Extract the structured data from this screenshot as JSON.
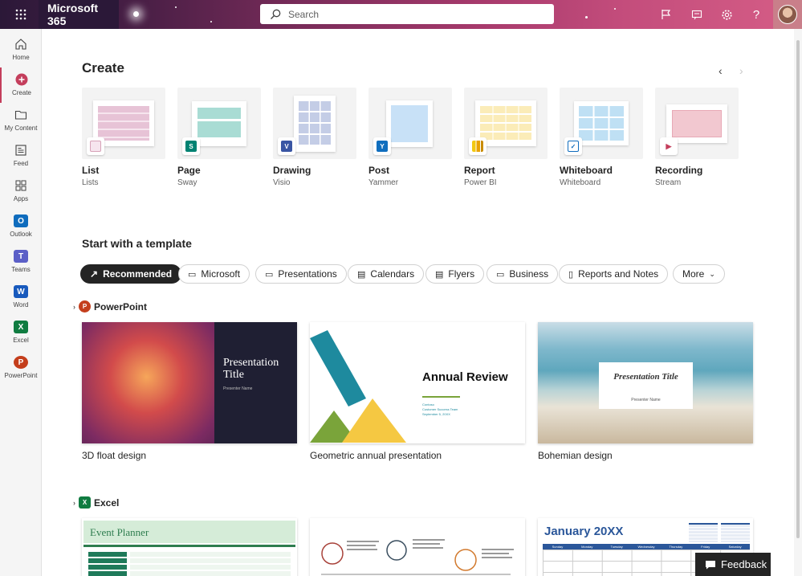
{
  "topbar": {
    "brand": "Microsoft 365",
    "search_placeholder": "Search",
    "icons": [
      "waffle-icon",
      "flag-icon",
      "feedback-icon",
      "gear-icon",
      "help-icon"
    ]
  },
  "rail": {
    "items": [
      {
        "label": "Home",
        "icon": "home-icon"
      },
      {
        "label": "Create",
        "icon": "plus-circle-icon"
      },
      {
        "label": "My Content",
        "icon": "folder-icon"
      },
      {
        "label": "Feed",
        "icon": "feed-icon"
      },
      {
        "label": "Apps",
        "icon": "apps-icon"
      },
      {
        "label": "Outlook",
        "icon": "outlook-icon"
      },
      {
        "label": "Teams",
        "icon": "teams-icon"
      },
      {
        "label": "Word",
        "icon": "word-icon"
      },
      {
        "label": "Excel",
        "icon": "excel-icon"
      },
      {
        "label": "PowerPoint",
        "icon": "powerpoint-icon"
      }
    ]
  },
  "create": {
    "title": "Create",
    "cards": [
      {
        "title": "List",
        "sub": "Lists",
        "accent": "#e7c3d6"
      },
      {
        "title": "Page",
        "sub": "Sway",
        "accent": "#a9dcd4"
      },
      {
        "title": "Drawing",
        "sub": "Visio",
        "accent": "#c4cde6"
      },
      {
        "title": "Post",
        "sub": "Yammer",
        "accent": "#c8e1f7"
      },
      {
        "title": "Report",
        "sub": "Power BI",
        "accent": "#fbecb8"
      },
      {
        "title": "Whiteboard",
        "sub": "Whiteboard",
        "accent": "#bfe0f4"
      },
      {
        "title": "Recording",
        "sub": "Stream",
        "accent": "#f2c8d0"
      }
    ]
  },
  "templates": {
    "title": "Start with a template",
    "filters": [
      "Recommended",
      "Microsoft",
      "Presentations",
      "Calendars",
      "Flyers",
      "Business",
      "Reports and Notes",
      "More"
    ],
    "powerpoint": {
      "label": "PowerPoint",
      "items": [
        {
          "name": "3D float design",
          "slide_title": "Presentation Title",
          "slide_sub": "Presenter Name"
        },
        {
          "name": "Geometric annual presentation",
          "slide_title": "Annual Review",
          "slide_sub1": "Contoso",
          "slide_sub2": "Customer Success Team",
          "slide_sub3": "September 5, 20XX"
        },
        {
          "name": "Bohemian design",
          "slide_title": "Presentation Title",
          "slide_sub": "Presenter Name"
        }
      ]
    },
    "excel": {
      "label": "Excel",
      "items": [
        {
          "title": "Event Planner"
        },
        {
          "title": ""
        },
        {
          "title": "January 20XX",
          "days": [
            "Sunday",
            "Monday",
            "Tuesday",
            "Wednesday",
            "Thursday",
            "Friday",
            "Saturday"
          ]
        }
      ]
    }
  },
  "feedback": {
    "label": "Feedback"
  }
}
